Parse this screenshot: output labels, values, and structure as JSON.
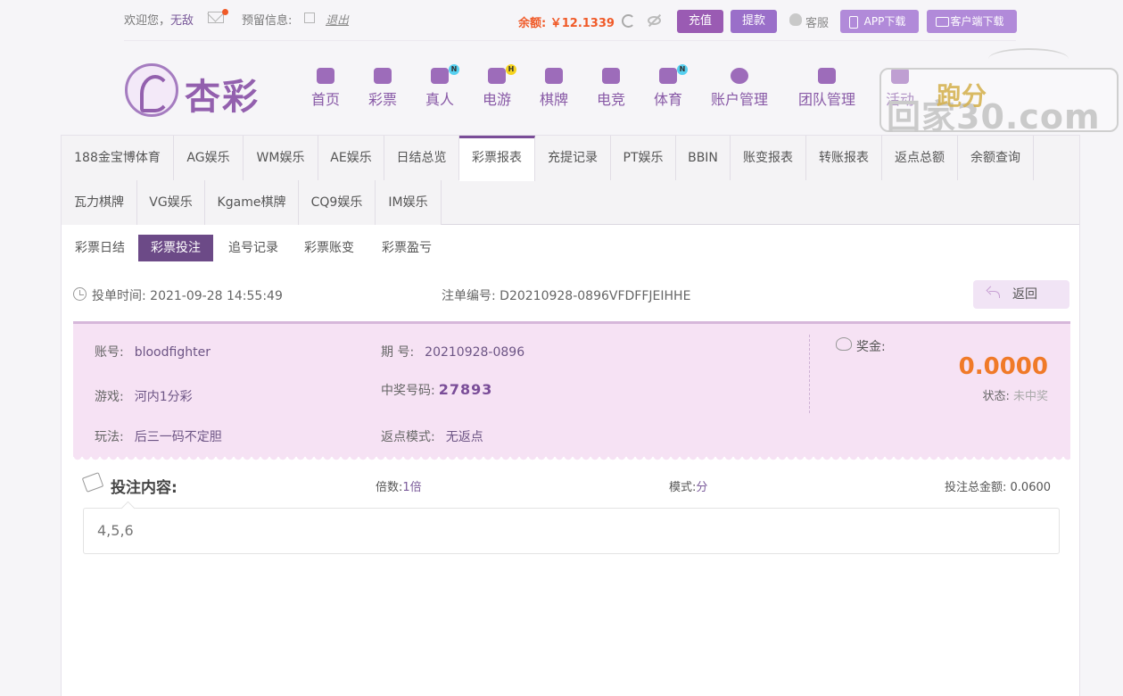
{
  "topbar": {
    "welcome": "欢迎您，",
    "username": "无敌",
    "reserve": "预留信息:",
    "logout": "退出",
    "balance": "余额: ￥12.1339",
    "recharge": "充值",
    "withdraw": "提款",
    "service": "客服",
    "app_download": "APP下载",
    "client_download": "客户端下载"
  },
  "logo": {
    "text": "杏彩"
  },
  "nav": [
    {
      "label": "首页",
      "icon": "home-icon",
      "badge": ""
    },
    {
      "label": "彩票",
      "icon": "ticket-icon",
      "badge": ""
    },
    {
      "label": "真人",
      "icon": "live-dealer-icon",
      "badge": "N"
    },
    {
      "label": "电游",
      "icon": "gamepad-icon",
      "badge": "H"
    },
    {
      "label": "棋牌",
      "icon": "cards-icon",
      "badge": ""
    },
    {
      "label": "电竞",
      "icon": "esports-icon",
      "badge": ""
    },
    {
      "label": "体育",
      "icon": "trophy-icon",
      "badge": "N"
    },
    {
      "label": "账户管理",
      "icon": "yen-coin-icon",
      "badge": ""
    },
    {
      "label": "团队管理",
      "icon": "team-icon",
      "badge": ""
    },
    {
      "label": "活动",
      "icon": "gift-icon",
      "badge": ""
    }
  ],
  "watermark": {
    "gold": "跑分",
    "text": "回家30.com"
  },
  "tabs": {
    "row1": [
      "188金宝博体育",
      "AG娱乐",
      "WM娱乐",
      "AE娱乐",
      "日结总览",
      "彩票报表",
      "充提记录",
      "PT娱乐",
      "BBIN",
      "账变报表",
      "转账报表",
      "返点总额",
      "余额查询"
    ],
    "row2": [
      "瓦力棋牌",
      "VG娱乐",
      "Kgame棋牌",
      "CQ9娱乐",
      "IM娱乐"
    ],
    "active": "彩票报表"
  },
  "subtabs": {
    "items": [
      "彩票日结",
      "彩票投注",
      "追号记录",
      "彩票账变",
      "彩票盈亏"
    ],
    "active": "彩票投注"
  },
  "order": {
    "time_label": "投单时间:",
    "time": "2021-09-28 14:55:49",
    "id_label": "注单编号:",
    "id": "D20210928-0896VFDFFJEIHHE",
    "back": "返回"
  },
  "detail": {
    "account_label": "账号:",
    "account": "bloodfighter",
    "issue_label": "期 号:",
    "issue": "20210928-0896",
    "game_label": "游戏:",
    "game": "河内1分彩",
    "win_number_label": "中奖号码:",
    "win_number": "27893",
    "play_label": "玩法:",
    "play": "后三一码不定胆",
    "rebate_label": "返点模式:",
    "rebate": "无返点",
    "prize_label": "奖金:",
    "prize": "0.0000",
    "status_label": "状态:",
    "status": "未中奖"
  },
  "bet": {
    "title": "投注内容:",
    "multiple_label": "倍数:",
    "multiple": "1倍",
    "mode_label": "模式:",
    "mode": "分",
    "total_label": "投注总金额:",
    "total": "0.0600",
    "content": "4,5,6"
  }
}
